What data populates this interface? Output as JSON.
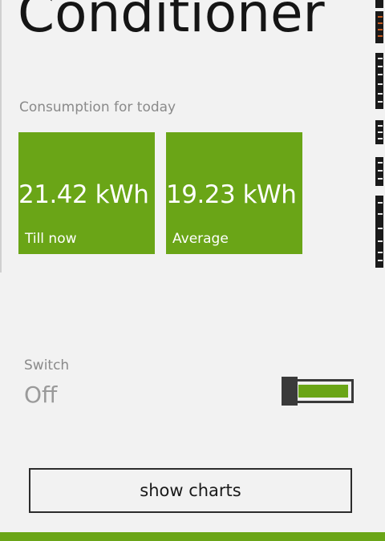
{
  "app": {
    "title": "Conditioner"
  },
  "consumption": {
    "label": "Consumption for today",
    "tiles": [
      {
        "value": "21.42 kWh",
        "label": "Till now"
      },
      {
        "value": "19.23 kWh",
        "label": "Average"
      }
    ]
  },
  "switch": {
    "label": "Switch",
    "state": "Off",
    "is_on": false
  },
  "actions": {
    "show_charts_label": "show charts"
  },
  "colors": {
    "accent": "#6aa517",
    "background": "#f2f2f2",
    "text": "#151515",
    "subtle_text": "#8a8a8a",
    "peek_highlight": "#c85a1e"
  }
}
